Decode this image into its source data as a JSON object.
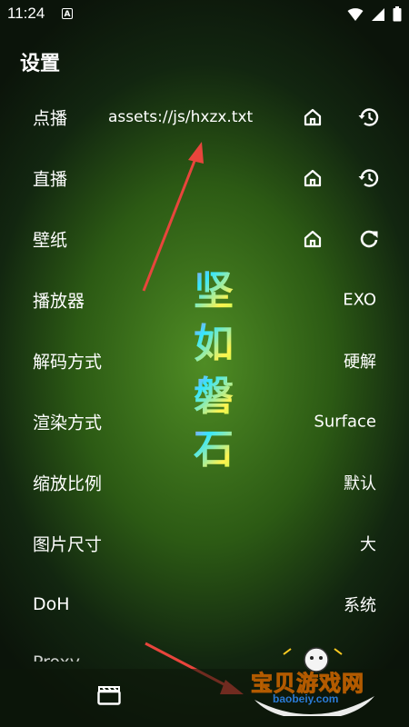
{
  "status_bar": {
    "time": "11:24",
    "notification_icon": "A"
  },
  "page": {
    "title": "设置"
  },
  "rows": [
    {
      "label": "点播",
      "value": "assets://js/hxzx.txt"
    },
    {
      "label": "直播"
    },
    {
      "label": "壁纸"
    },
    {
      "label": "播放器",
      "value": "EXO"
    },
    {
      "label": "解码方式",
      "value": "硬解"
    },
    {
      "label": "渲染方式",
      "value": "Surface"
    },
    {
      "label": "缩放比例",
      "value": "默认"
    },
    {
      "label": "图片尺寸",
      "value": "大"
    },
    {
      "label": "DoH",
      "value": "系统"
    },
    {
      "label": "Proxy"
    }
  ],
  "wallpaper_text": [
    "坚",
    "如",
    "磐",
    "石"
  ],
  "watermark": {
    "name": "宝贝游戏网",
    "url": "baobeiy.com"
  },
  "colors": {
    "arrow": "#e8453c",
    "watermark_yellow": "#ffcc22"
  }
}
